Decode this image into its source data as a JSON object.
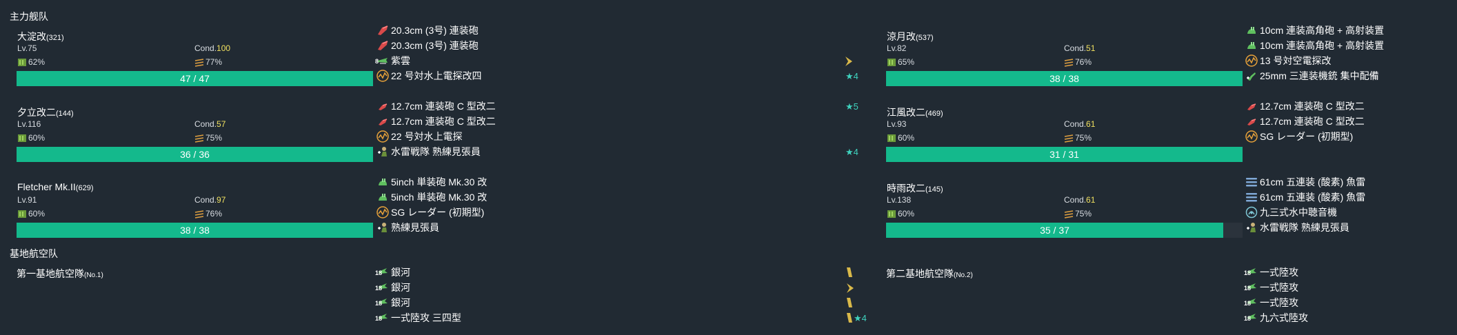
{
  "main_fleet": {
    "title": "主力舰队",
    "left_ships": [
      {
        "name": "大淀改",
        "id": "(321)",
        "lv": "Lv.75",
        "cond_label": "Cond.",
        "cond": "100",
        "fuel": "62%",
        "ammo": "77%",
        "hp": "47 / 47",
        "equip": [
          {
            "name": "20.3cm (3号) 連装砲",
            "icon": "red-gun-icon"
          },
          {
            "name": "20.3cm (3号) 連装砲",
            "icon": "red-gun-icon"
          },
          {
            "name": "紫雲",
            "icon": "seaplane-icon",
            "num": "8"
          },
          {
            "name": "22 号対水上電探改四",
            "icon": "radar-icon"
          }
        ],
        "right_marks": [
          {
            "idx": 2,
            "type": "chevron"
          },
          {
            "idx": 3,
            "type": "star",
            "text": "★4"
          }
        ]
      },
      {
        "name": "夕立改二",
        "id": "(144)",
        "lv": "Lv.116",
        "cond_label": "Cond.",
        "cond": "57",
        "fuel": "60%",
        "ammo": "75%",
        "hp": "36 / 36",
        "equip": [
          {
            "name": "12.7cm 連装砲 C 型改二",
            "icon": "small-red-gun-icon"
          },
          {
            "name": "12.7cm 連装砲 C 型改二",
            "icon": "small-red-gun-icon"
          },
          {
            "name": "22 号対水上電探",
            "icon": "radar-icon"
          },
          {
            "name": "水雷戦隊 熟練見張員",
            "icon": "lookout-icon"
          }
        ],
        "right_marks": [
          {
            "idx": 0,
            "type": "star",
            "text": "★5"
          },
          {
            "idx": 3,
            "type": "star",
            "text": "★4"
          }
        ]
      },
      {
        "name": "Fletcher Mk.II",
        "id": "(629)",
        "lv": "Lv.91",
        "cond_label": "Cond.",
        "cond": "97",
        "fuel": "60%",
        "ammo": "76%",
        "hp": "38 / 38",
        "equip": [
          {
            "name": "5inch 単装砲 Mk.30 改",
            "icon": "green-gun-icon"
          },
          {
            "name": "5inch 単装砲 Mk.30 改",
            "icon": "green-gun-icon"
          },
          {
            "name": "SG レーダー (初期型)",
            "icon": "radar-icon"
          },
          {
            "name": "熟練見張員",
            "icon": "lookout-icon"
          }
        ],
        "right_marks": []
      }
    ],
    "right_ships": [
      {
        "name": "涼月改",
        "id": "(537)",
        "lv": "Lv.82",
        "cond_label": "Cond.",
        "cond": "51",
        "fuel": "65%",
        "ammo": "76%",
        "hp": "38 / 38",
        "equip": [
          {
            "name": "10cm 連装高角砲 + 高射装置",
            "icon": "green-gun-icon"
          },
          {
            "name": "10cm 連装高角砲 + 高射装置",
            "icon": "green-gun-icon"
          },
          {
            "name": "13 号対空電探改",
            "icon": "radar-icon"
          },
          {
            "name": "25mm 三連装機銃 集中配備",
            "icon": "aa-gun-icon"
          }
        ]
      },
      {
        "name": "江風改二",
        "id": "(469)",
        "lv": "Lv.93",
        "cond_label": "Cond.",
        "cond": "61",
        "fuel": "60%",
        "ammo": "75%",
        "hp": "31 / 31",
        "equip": [
          {
            "name": "12.7cm 連装砲 C 型改二",
            "icon": "small-red-gun-icon"
          },
          {
            "name": "12.7cm 連装砲 C 型改二",
            "icon": "small-red-gun-icon"
          },
          {
            "name": "SG レーダー (初期型)",
            "icon": "radar-icon"
          }
        ]
      },
      {
        "name": "時雨改二",
        "id": "(145)",
        "lv": "Lv.138",
        "cond_label": "Cond.",
        "cond": "61",
        "fuel": "60%",
        "ammo": "75%",
        "hp": "35 / 37",
        "hp_fraction": 0.946,
        "equip": [
          {
            "name": "61cm 五連装 (酸素) 魚雷",
            "icon": "torpedo-icon"
          },
          {
            "name": "61cm 五連装 (酸素) 魚雷",
            "icon": "torpedo-icon"
          },
          {
            "name": "九三式水中聴音機",
            "icon": "sonar-icon"
          },
          {
            "name": "水雷戦隊 熟練見張員",
            "icon": "lookout-icon"
          }
        ]
      }
    ]
  },
  "air_base": {
    "title": "基地航空队",
    "left": {
      "name": "第一基地航空隊",
      "no": "(No.1)",
      "planes": [
        {
          "name": "銀河",
          "num": "18"
        },
        {
          "name": "銀河",
          "num": "18"
        },
        {
          "name": "銀河",
          "num": "18"
        },
        {
          "name": "一式陸攻 三四型",
          "num": "18"
        }
      ],
      "marks": [
        {
          "idx": 0,
          "type": "bar"
        },
        {
          "idx": 1,
          "type": "chevron"
        },
        {
          "idx": 2,
          "type": "bar"
        },
        {
          "idx": 3,
          "type": "bar-star",
          "text": "★4"
        }
      ]
    },
    "right": {
      "name": "第二基地航空隊",
      "no": "(No.2)",
      "planes": [
        {
          "name": "一式陸攻",
          "num": "18"
        },
        {
          "name": "一式陸攻",
          "num": "18"
        },
        {
          "name": "一式陸攻",
          "num": "18"
        },
        {
          "name": "九六式陸攻",
          "num": "18"
        }
      ]
    }
  },
  "colors": {
    "background": "#212a33",
    "hp_bar": "#14b98c",
    "cond": "#f0e060",
    "star": "#3fd2be",
    "proficiency": "#d9b94a"
  }
}
